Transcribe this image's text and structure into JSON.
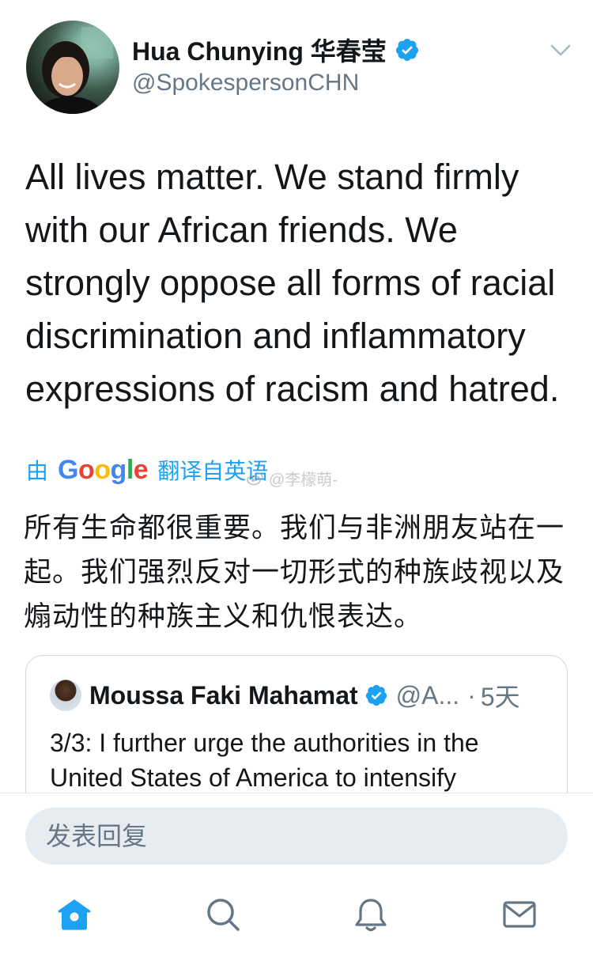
{
  "tweet": {
    "author": {
      "display_name": "Hua Chunying 华春莹",
      "handle": "@SpokespersonCHN",
      "verified": true
    },
    "text": "All lives matter. We stand firmly with our African friends. We strongly oppose all forms of racial discrimination and inflammatory expressions of racism and hatred.",
    "translation": {
      "prefix": "由",
      "provider": "Google",
      "suffix": "翻译自英语",
      "text": "所有生命都很重要。我们与非洲朋友站在一起。我们强烈反对一切形式的种族歧视以及煽动性的种族主义和仇恨表达。"
    },
    "watermark": "@李檬萌-"
  },
  "quoted_tweet": {
    "display_name": "Moussa Faki Mahamat",
    "verified": true,
    "handle": "@A...",
    "separator": "·",
    "time": "5天",
    "text": "3/3: I further urge the authorities in the United States of America to intensify"
  },
  "reply": {
    "placeholder": "发表回复"
  },
  "tabs": [
    {
      "name": "home",
      "icon": "home-icon",
      "active": true
    },
    {
      "name": "search",
      "icon": "search-icon",
      "active": false
    },
    {
      "name": "notifications",
      "icon": "bell-icon",
      "active": false
    },
    {
      "name": "messages",
      "icon": "mail-icon",
      "active": false
    }
  ],
  "colors": {
    "accent": "#1da1f2",
    "text": "#14171a",
    "secondary_text": "#657786",
    "border": "#ccd6dd",
    "input_bg": "#e6ecf0"
  }
}
